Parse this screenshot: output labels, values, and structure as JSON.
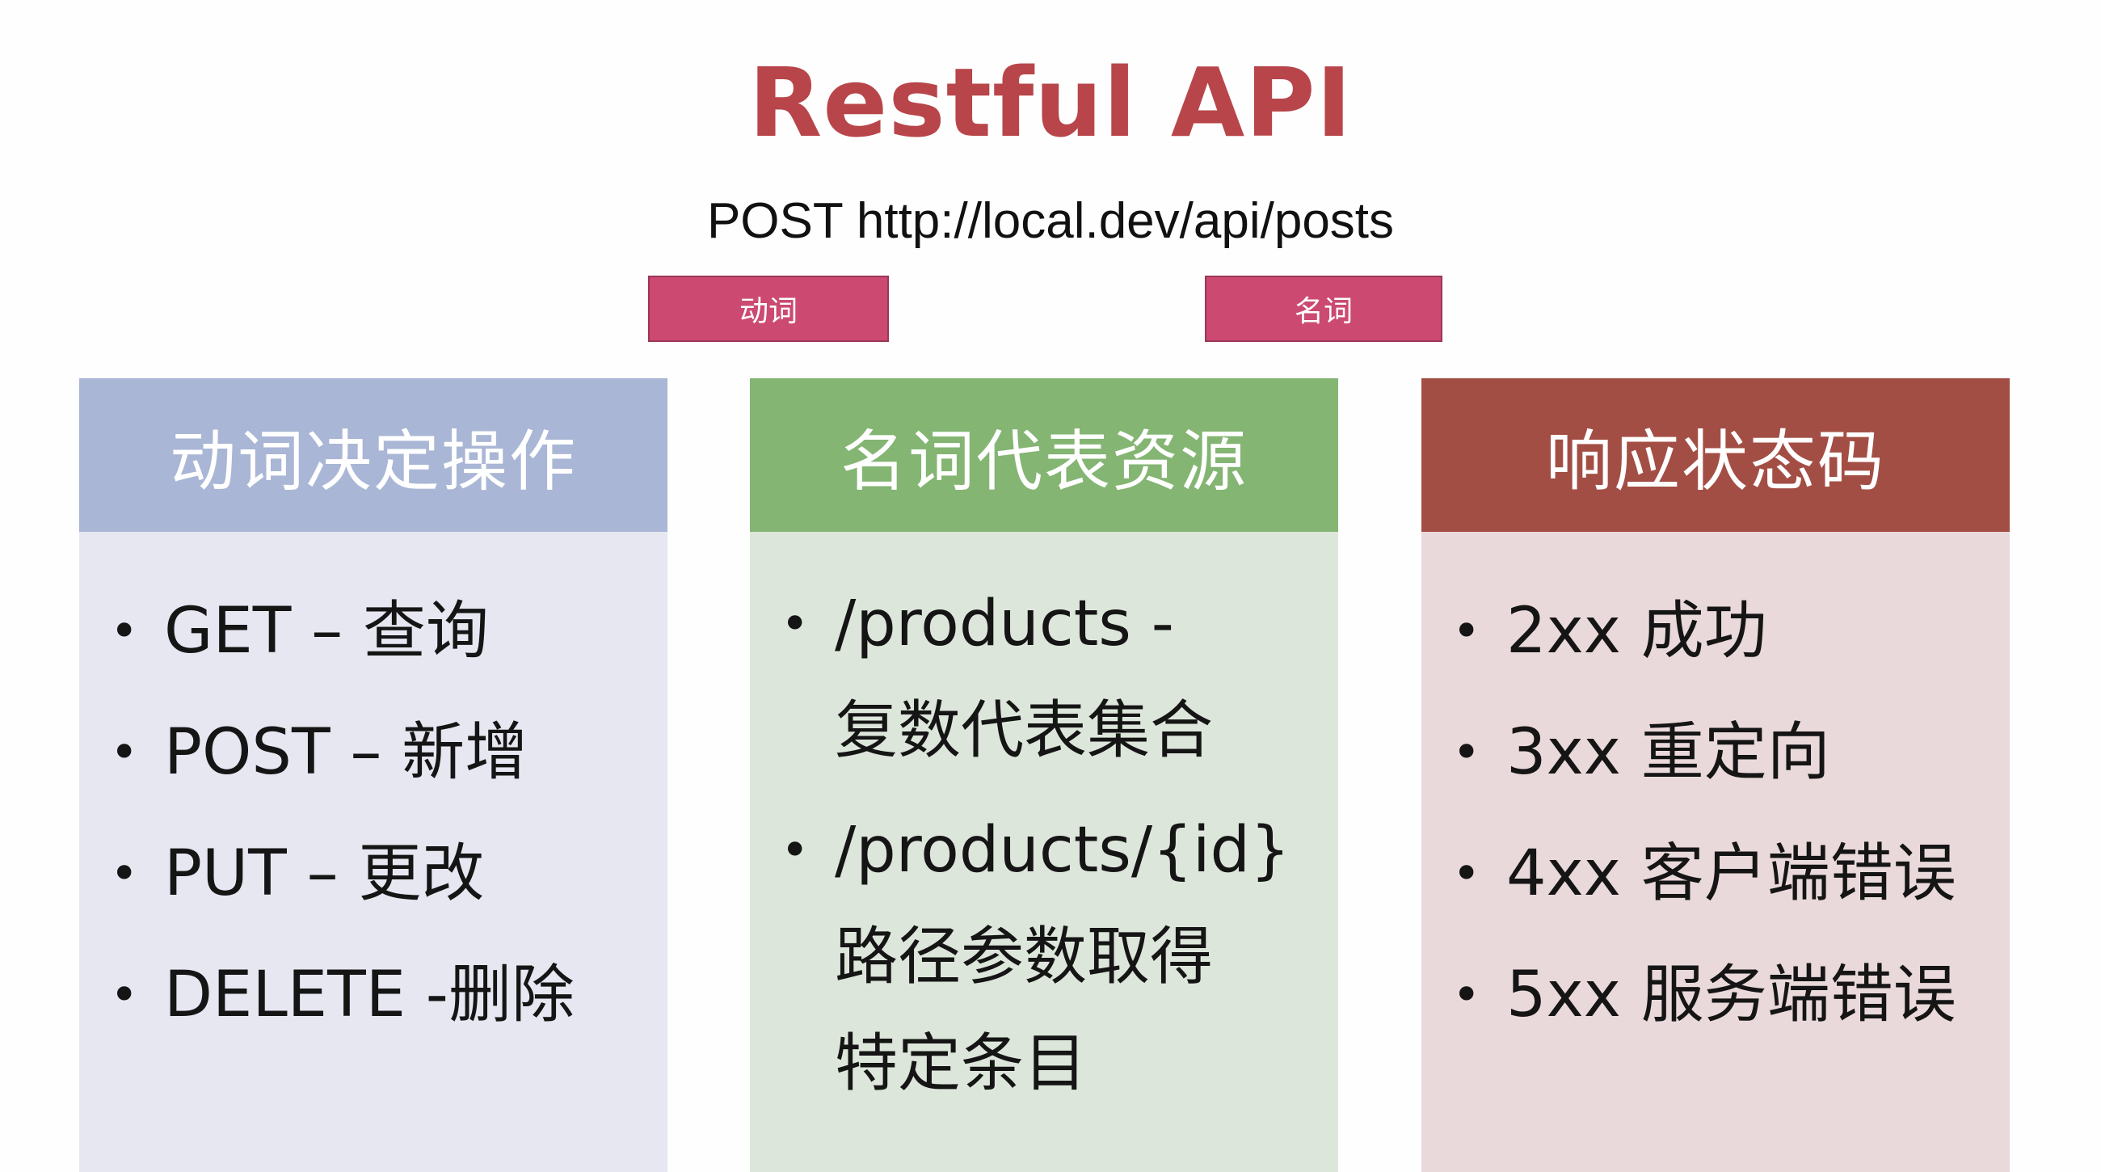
{
  "title": "Restful API",
  "request_line": "POST http://local.dev/api/posts",
  "tags": {
    "verb": "动词",
    "noun": "名词"
  },
  "panels": [
    {
      "header": "动词决定操作",
      "color": "#a9b6d5",
      "items": [
        "GET – 查询",
        "POST – 新增",
        "PUT – 更改",
        "DELETE -删除"
      ]
    },
    {
      "header": "名词代表资源",
      "color": "#84b573",
      "items": [
        {
          "line1": "/products -",
          "line2": "复数代表集合"
        },
        {
          "line1": "/products/{id}",
          "line2": "路径参数取得",
          "line3": "特定条目"
        }
      ]
    },
    {
      "header": "响应状态码",
      "color": "#a34e45",
      "items": [
        "2xx 成功",
        "3xx 重定向",
        "4xx 客户端错误",
        "5xx 服务端错误"
      ]
    }
  ]
}
